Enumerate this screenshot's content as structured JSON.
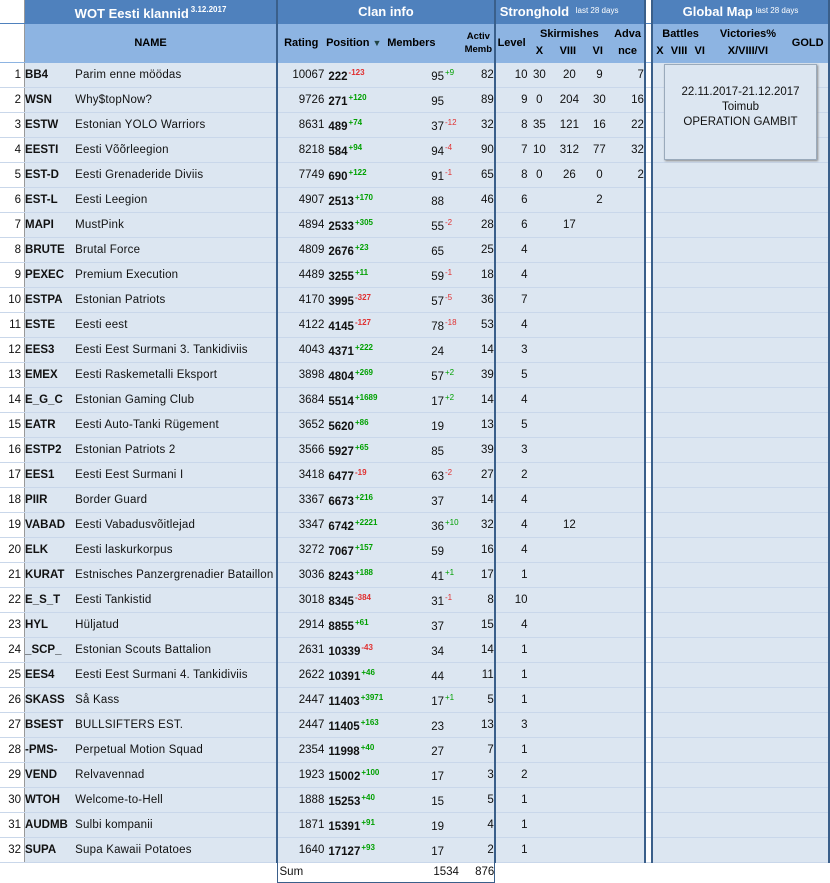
{
  "header": {
    "clans_title": "WOT Eesti klannid",
    "date": "3.12.2017",
    "clan_info": "Clan info",
    "stronghold": "Stronghold",
    "stronghold_note": "last 28 days",
    "global_map": "Global Map",
    "global_map_note": "last 28 days"
  },
  "columns": {
    "name": "NAME",
    "rating": "Rating",
    "position": "Position",
    "sort_icon": "▼",
    "members": "Members",
    "activ_1": "Activ",
    "activ_2": "Memb",
    "level": "Level",
    "skirmishes": "Skirmishes",
    "skx": "X",
    "skviii": "VIII",
    "skvi": "VI",
    "advance_1": "Adva",
    "advance_2": "nce",
    "battles": "Battles",
    "victories": "Victories%",
    "gx": "X",
    "gviii": "VIII",
    "gvi": "VI",
    "vic_sub": "X/VIII/VI",
    "gold": "GOLD"
  },
  "rows": [
    {
      "n": "1",
      "tag": "BB4",
      "name": "Parim enne möödas",
      "rating": "10067",
      "pos": "222",
      "pd": "-123",
      "mem": "95",
      "md": "+9",
      "act": "82",
      "lvl": "10",
      "x": "30",
      "viii": "20",
      "vi": "9",
      "adv": "7"
    },
    {
      "n": "2",
      "tag": "WSN",
      "name": "Why$topNow?",
      "rating": "9726",
      "pos": "271",
      "pd": "+120",
      "mem": "95",
      "md": "",
      "act": "89",
      "lvl": "9",
      "x": "0",
      "viii": "204",
      "vi": "30",
      "adv": "16"
    },
    {
      "n": "3",
      "tag": "ESTW",
      "name": "Estonian YOLO Warriors",
      "rating": "8631",
      "pos": "489",
      "pd": "+74",
      "mem": "37",
      "md": "-12",
      "act": "32",
      "lvl": "8",
      "x": "35",
      "viii": "121",
      "vi": "16",
      "adv": "22"
    },
    {
      "n": "4",
      "tag": "EESTI",
      "name": "Eesti Võõrleegion",
      "rating": "8218",
      "pos": "584",
      "pd": "+94",
      "mem": "94",
      "md": "-4",
      "act": "90",
      "lvl": "7",
      "x": "10",
      "viii": "312",
      "vi": "77",
      "adv": "32"
    },
    {
      "n": "5",
      "tag": "EST-D",
      "name": "Eesti Grenaderide Diviis",
      "rating": "7749",
      "pos": "690",
      "pd": "+122",
      "mem": "91",
      "md": "-1",
      "act": "65",
      "lvl": "8",
      "x": "0",
      "viii": "26",
      "vi": "0",
      "adv": "2"
    },
    {
      "n": "6",
      "tag": "EST-L",
      "name": "Eesti Leegion",
      "rating": "4907",
      "pos": "2513",
      "pd": "+170",
      "mem": "88",
      "md": "",
      "act": "46",
      "lvl": "6",
      "x": "",
      "viii": "",
      "vi": "2",
      "adv": ""
    },
    {
      "n": "7",
      "tag": "MAPI",
      "name": "MustPink",
      "rating": "4894",
      "pos": "2533",
      "pd": "+305",
      "mem": "55",
      "md": "-2",
      "act": "28",
      "lvl": "6",
      "x": "",
      "viii": "17",
      "vi": "",
      "adv": ""
    },
    {
      "n": "8",
      "tag": "BRUTE",
      "name": "Brutal Force",
      "rating": "4809",
      "pos": "2676",
      "pd": "+23",
      "mem": "65",
      "md": "",
      "act": "25",
      "lvl": "4",
      "x": "",
      "viii": "",
      "vi": "",
      "adv": ""
    },
    {
      "n": "9",
      "tag": "PEXEC",
      "name": "Premium Execution",
      "rating": "4489",
      "pos": "3255",
      "pd": "+11",
      "mem": "59",
      "md": "-1",
      "act": "18",
      "lvl": "4",
      "x": "",
      "viii": "",
      "vi": "",
      "adv": ""
    },
    {
      "n": "10",
      "tag": "ESTPA",
      "name": "Estonian Patriots",
      "rating": "4170",
      "pos": "3995",
      "pd": "-327",
      "mem": "57",
      "md": "-5",
      "act": "36",
      "lvl": "7",
      "x": "",
      "viii": "",
      "vi": "",
      "adv": ""
    },
    {
      "n": "11",
      "tag": "ESTE",
      "name": "Eesti eest",
      "rating": "4122",
      "pos": "4145",
      "pd": "-127",
      "mem": "78",
      "md": "-18",
      "act": "53",
      "lvl": "4",
      "x": "",
      "viii": "",
      "vi": "",
      "adv": ""
    },
    {
      "n": "12",
      "tag": "EES3",
      "name": "Eesti Eest Surmani 3. Tankidiviis",
      "rating": "4043",
      "pos": "4371",
      "pd": "+222",
      "mem": "24",
      "md": "",
      "act": "14",
      "lvl": "3",
      "x": "",
      "viii": "",
      "vi": "",
      "adv": ""
    },
    {
      "n": "13",
      "tag": "EMEX",
      "name": "Eesti Raskemetalli Eksport",
      "rating": "3898",
      "pos": "4804",
      "pd": "+269",
      "mem": "57",
      "md": "+2",
      "act": "39",
      "lvl": "5",
      "x": "",
      "viii": "",
      "vi": "",
      "adv": ""
    },
    {
      "n": "14",
      "tag": "E_G_C",
      "name": "Estonian Gaming Club",
      "rating": "3684",
      "pos": "5514",
      "pd": "+1689",
      "mem": "17",
      "md": "+2",
      "act": "14",
      "lvl": "4",
      "x": "",
      "viii": "",
      "vi": "",
      "adv": ""
    },
    {
      "n": "15",
      "tag": "EATR",
      "name": "Eesti Auto-Tanki Rügement",
      "rating": "3652",
      "pos": "5620",
      "pd": "+86",
      "mem": "19",
      "md": "",
      "act": "13",
      "lvl": "5",
      "x": "",
      "viii": "",
      "vi": "",
      "adv": ""
    },
    {
      "n": "16",
      "tag": "ESTP2",
      "name": "Estonian Patriots 2",
      "rating": "3566",
      "pos": "5927",
      "pd": "+65",
      "mem": "85",
      "md": "",
      "act": "39",
      "lvl": "3",
      "x": "",
      "viii": "",
      "vi": "",
      "adv": ""
    },
    {
      "n": "17",
      "tag": "EES1",
      "name": "Eesti Eest Surmani I",
      "rating": "3418",
      "pos": "6477",
      "pd": "-19",
      "mem": "63",
      "md": "-2",
      "act": "27",
      "lvl": "2",
      "x": "",
      "viii": "",
      "vi": "",
      "adv": ""
    },
    {
      "n": "18",
      "tag": "PIIR",
      "name": "Border Guard",
      "rating": "3367",
      "pos": "6673",
      "pd": "+216",
      "mem": "37",
      "md": "",
      "act": "14",
      "lvl": "4",
      "x": "",
      "viii": "",
      "vi": "",
      "adv": ""
    },
    {
      "n": "19",
      "tag": "VABAD",
      "name": "Eesti Vabadusvõitlejad",
      "rating": "3347",
      "pos": "6742",
      "pd": "+2221",
      "mem": "36",
      "md": "+10",
      "act": "32",
      "lvl": "4",
      "x": "",
      "viii": "12",
      "vi": "",
      "adv": ""
    },
    {
      "n": "20",
      "tag": "ELK",
      "name": "Eesti laskurkorpus",
      "rating": "3272",
      "pos": "7067",
      "pd": "+157",
      "mem": "59",
      "md": "",
      "act": "16",
      "lvl": "4",
      "x": "",
      "viii": "",
      "vi": "",
      "adv": ""
    },
    {
      "n": "21",
      "tag": "KURAT",
      "name": "Estnisches Panzergrenadier Bataillon",
      "rating": "3036",
      "pos": "8243",
      "pd": "+188",
      "mem": "41",
      "md": "+1",
      "act": "17",
      "lvl": "1",
      "x": "",
      "viii": "",
      "vi": "",
      "adv": ""
    },
    {
      "n": "22",
      "tag": "E_S_T",
      "name": "Eesti Tankistid",
      "rating": "3018",
      "pos": "8345",
      "pd": "-384",
      "mem": "31",
      "md": "-1",
      "act": "8",
      "lvl": "10",
      "x": "",
      "viii": "",
      "vi": "",
      "adv": ""
    },
    {
      "n": "23",
      "tag": "HYL",
      "name": "Hüljatud",
      "rating": "2914",
      "pos": "8855",
      "pd": "+61",
      "mem": "37",
      "md": "",
      "act": "15",
      "lvl": "4",
      "x": "",
      "viii": "",
      "vi": "",
      "adv": ""
    },
    {
      "n": "24",
      "tag": "_SCP_",
      "name": "Estonian Scouts Battalion",
      "rating": "2631",
      "pos": "10339",
      "pd": "-43",
      "mem": "34",
      "md": "",
      "act": "14",
      "lvl": "1",
      "x": "",
      "viii": "",
      "vi": "",
      "adv": ""
    },
    {
      "n": "25",
      "tag": "EES4",
      "name": "Eesti Eest Surmani 4. Tankidiviis",
      "rating": "2622",
      "pos": "10391",
      "pd": "+46",
      "mem": "44",
      "md": "",
      "act": "11",
      "lvl": "1",
      "x": "",
      "viii": "",
      "vi": "",
      "adv": ""
    },
    {
      "n": "26",
      "tag": "SKASS",
      "name": "Så Kass",
      "rating": "2447",
      "pos": "11403",
      "pd": "+3971",
      "mem": "17",
      "md": "+1",
      "act": "5",
      "lvl": "1",
      "x": "",
      "viii": "",
      "vi": "",
      "adv": ""
    },
    {
      "n": "27",
      "tag": "BSEST",
      "name": "BULLSIFTERS EST.",
      "rating": "2447",
      "pos": "11405",
      "pd": "+163",
      "mem": "23",
      "md": "",
      "act": "13",
      "lvl": "3",
      "x": "",
      "viii": "",
      "vi": "",
      "adv": ""
    },
    {
      "n": "28",
      "tag": "-PMS-",
      "name": "Perpetual Motion Squad",
      "rating": "2354",
      "pos": "11998",
      "pd": "+40",
      "mem": "27",
      "md": "",
      "act": "7",
      "lvl": "1",
      "x": "",
      "viii": "",
      "vi": "",
      "adv": ""
    },
    {
      "n": "29",
      "tag": "VEND",
      "name": "Relvavennad",
      "rating": "1923",
      "pos": "15002",
      "pd": "+100",
      "mem": "17",
      "md": "",
      "act": "3",
      "lvl": "2",
      "x": "",
      "viii": "",
      "vi": "",
      "adv": ""
    },
    {
      "n": "30",
      "tag": "WTOH",
      "name": "Welcome-to-Hell",
      "rating": "1888",
      "pos": "15253",
      "pd": "+40",
      "mem": "15",
      "md": "",
      "act": "5",
      "lvl": "1",
      "x": "",
      "viii": "",
      "vi": "",
      "adv": ""
    },
    {
      "n": "31",
      "tag": "AUDMB",
      "name": "Sulbi kompanii",
      "rating": "1871",
      "pos": "15391",
      "pd": "+91",
      "mem": "19",
      "md": "",
      "act": "4",
      "lvl": "1",
      "x": "",
      "viii": "",
      "vi": "",
      "adv": ""
    },
    {
      "n": "32",
      "tag": "SUPA",
      "name": "Supa Kawaii Potatoes",
      "rating": "1640",
      "pos": "17127",
      "pd": "+93",
      "mem": "17",
      "md": "",
      "act": "2",
      "lvl": "1",
      "x": "",
      "viii": "",
      "vi": "",
      "adv": ""
    }
  ],
  "sum": {
    "label": "Sum",
    "members": "1534",
    "active": "876"
  },
  "global_map_event": {
    "dates": "22.11.2017-21.12.2017",
    "status": "Toimub",
    "operation": "OPERATION GAMBIT"
  },
  "colors": {
    "header_dark": "#4f81bd",
    "header_light": "#8db4e2",
    "row": "#dce6f1",
    "positive": "#00a000",
    "negative": "#e03030"
  }
}
